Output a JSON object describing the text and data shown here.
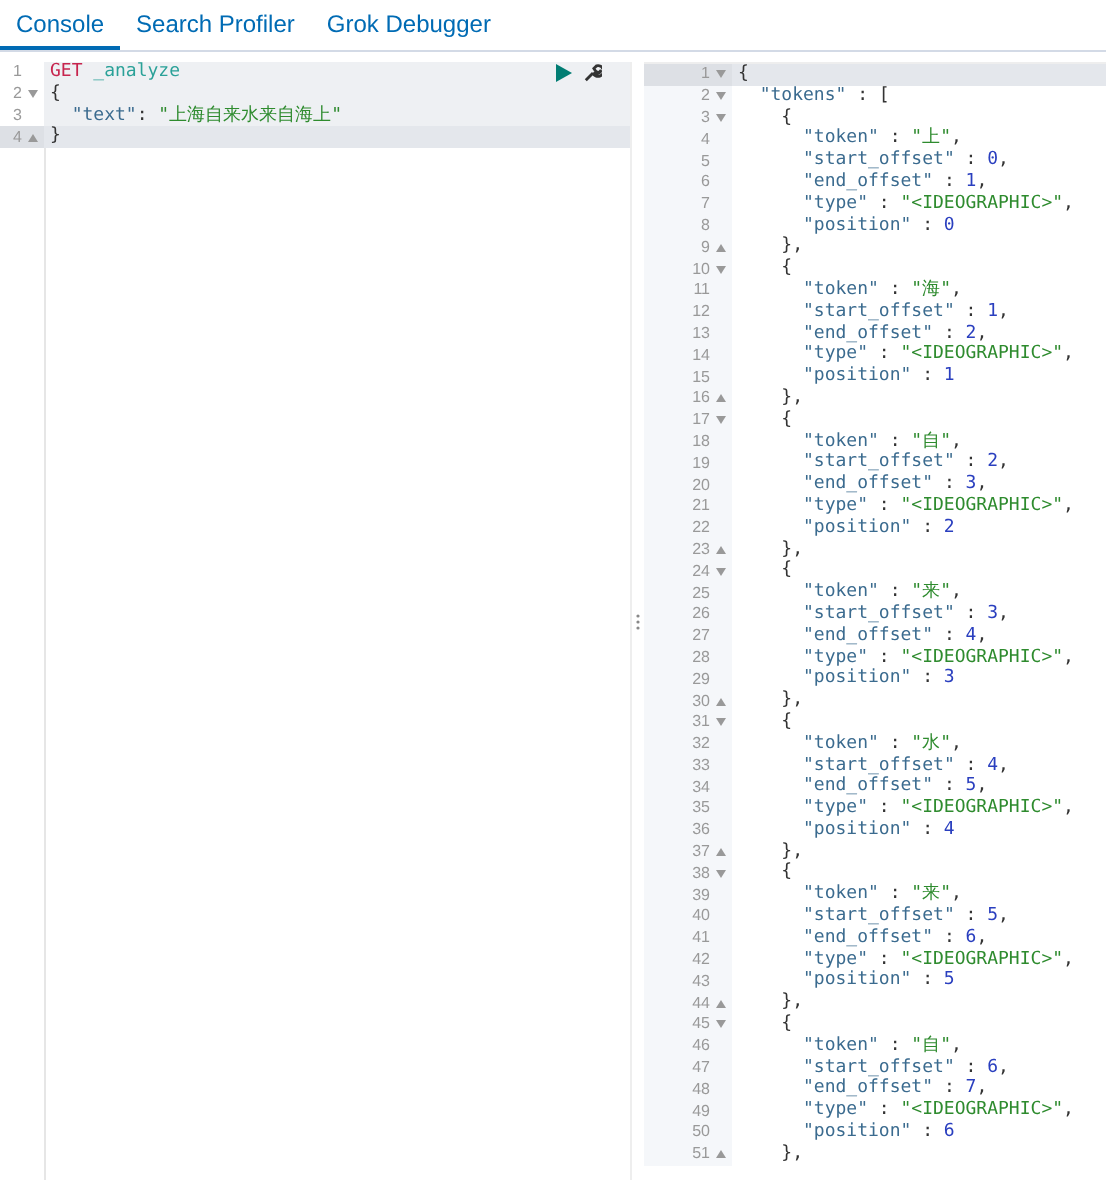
{
  "tabs": [
    {
      "label": "Console",
      "selected": true
    },
    {
      "label": "Search Profiler",
      "selected": false
    },
    {
      "label": "Grok Debugger",
      "selected": false
    }
  ],
  "request": {
    "lines": [
      {
        "n": "1",
        "active": false,
        "parts": [
          {
            "kind": "method",
            "text": "GET"
          },
          {
            "kind": "path",
            "text": "_analyze"
          }
        ]
      },
      {
        "n": "2",
        "fold_start": true,
        "active": false,
        "parts": [
          {
            "kind": "punct",
            "text": "{"
          }
        ]
      },
      {
        "n": "3",
        "active": false,
        "parts": [
          {
            "kind": "key",
            "text": "\"text\""
          },
          {
            "kind": "punct",
            "text": ":"
          },
          {
            "kind": "string",
            "text": "\"上海自来水来自海上\""
          }
        ]
      },
      {
        "n": "4",
        "fold_end": true,
        "active": true,
        "parts": [
          {
            "kind": "punct",
            "text": "}"
          }
        ]
      }
    ]
  },
  "response": {
    "lines": [
      {
        "n": "1",
        "fold_start": true,
        "active": true,
        "parts": [
          {
            "kind": "punct",
            "text": "{"
          }
        ]
      },
      {
        "n": "2",
        "fold_start": true,
        "active": false,
        "parts": [
          {
            "kind": "key",
            "text": "\"tokens\""
          },
          {
            "kind": "colon",
            "text": ":"
          },
          {
            "kind": "punct",
            "text": "["
          }
        ]
      },
      {
        "n": "3",
        "fold_start": true,
        "active": false,
        "parts": [
          {
            "kind": "punct",
            "text": "{"
          }
        ]
      },
      {
        "n": "4",
        "active": false,
        "parts": [
          {
            "kind": "key",
            "text": "\"token\""
          },
          {
            "kind": "colon",
            "text": ":"
          },
          {
            "kind": "string",
            "text": "\"上\""
          },
          {
            "kind": "punct",
            "text": ","
          }
        ]
      },
      {
        "n": "5",
        "active": false,
        "parts": [
          {
            "kind": "key",
            "text": "\"start_offset\""
          },
          {
            "kind": "colon",
            "text": ":"
          },
          {
            "kind": "number",
            "text": "0"
          },
          {
            "kind": "punct",
            "text": ","
          }
        ]
      },
      {
        "n": "6",
        "active": false,
        "parts": [
          {
            "kind": "key",
            "text": "\"end_offset\""
          },
          {
            "kind": "colon",
            "text": ":"
          },
          {
            "kind": "number",
            "text": "1"
          },
          {
            "kind": "punct",
            "text": ","
          }
        ]
      },
      {
        "n": "7",
        "active": false,
        "parts": [
          {
            "kind": "key",
            "text": "\"type\""
          },
          {
            "kind": "colon",
            "text": ":"
          },
          {
            "kind": "string",
            "text": "\"<IDEOGRAPHIC>\""
          },
          {
            "kind": "punct",
            "text": ","
          }
        ]
      },
      {
        "n": "8",
        "active": false,
        "parts": [
          {
            "kind": "key",
            "text": "\"position\""
          },
          {
            "kind": "colon",
            "text": ":"
          },
          {
            "kind": "number",
            "text": "0"
          }
        ]
      },
      {
        "n": "9",
        "fold_end": true,
        "active": false,
        "parts": [
          {
            "kind": "punct",
            "text": "},"
          }
        ]
      },
      {
        "n": "10",
        "fold_start": true,
        "active": false,
        "parts": [
          {
            "kind": "punct",
            "text": "{"
          }
        ]
      },
      {
        "n": "11",
        "active": false,
        "parts": [
          {
            "kind": "key",
            "text": "\"token\""
          },
          {
            "kind": "colon",
            "text": ":"
          },
          {
            "kind": "string",
            "text": "\"海\""
          },
          {
            "kind": "punct",
            "text": ","
          }
        ]
      },
      {
        "n": "12",
        "active": false,
        "parts": [
          {
            "kind": "key",
            "text": "\"start_offset\""
          },
          {
            "kind": "colon",
            "text": ":"
          },
          {
            "kind": "number",
            "text": "1"
          },
          {
            "kind": "punct",
            "text": ","
          }
        ]
      },
      {
        "n": "13",
        "active": false,
        "parts": [
          {
            "kind": "key",
            "text": "\"end_offset\""
          },
          {
            "kind": "colon",
            "text": ":"
          },
          {
            "kind": "number",
            "text": "2"
          },
          {
            "kind": "punct",
            "text": ","
          }
        ]
      },
      {
        "n": "14",
        "active": false,
        "parts": [
          {
            "kind": "key",
            "text": "\"type\""
          },
          {
            "kind": "colon",
            "text": ":"
          },
          {
            "kind": "string",
            "text": "\"<IDEOGRAPHIC>\""
          },
          {
            "kind": "punct",
            "text": ","
          }
        ]
      },
      {
        "n": "15",
        "active": false,
        "parts": [
          {
            "kind": "key",
            "text": "\"position\""
          },
          {
            "kind": "colon",
            "text": ":"
          },
          {
            "kind": "number",
            "text": "1"
          }
        ]
      },
      {
        "n": "16",
        "fold_end": true,
        "active": false,
        "parts": [
          {
            "kind": "punct",
            "text": "},"
          }
        ]
      },
      {
        "n": "17",
        "fold_start": true,
        "active": false,
        "parts": [
          {
            "kind": "punct",
            "text": "{"
          }
        ]
      },
      {
        "n": "18",
        "active": false,
        "parts": [
          {
            "kind": "key",
            "text": "\"token\""
          },
          {
            "kind": "colon",
            "text": ":"
          },
          {
            "kind": "string",
            "text": "\"自\""
          },
          {
            "kind": "punct",
            "text": ","
          }
        ]
      },
      {
        "n": "19",
        "active": false,
        "parts": [
          {
            "kind": "key",
            "text": "\"start_offset\""
          },
          {
            "kind": "colon",
            "text": ":"
          },
          {
            "kind": "number",
            "text": "2"
          },
          {
            "kind": "punct",
            "text": ","
          }
        ]
      },
      {
        "n": "20",
        "active": false,
        "parts": [
          {
            "kind": "key",
            "text": "\"end_offset\""
          },
          {
            "kind": "colon",
            "text": ":"
          },
          {
            "kind": "number",
            "text": "3"
          },
          {
            "kind": "punct",
            "text": ","
          }
        ]
      },
      {
        "n": "21",
        "active": false,
        "parts": [
          {
            "kind": "key",
            "text": "\"type\""
          },
          {
            "kind": "colon",
            "text": ":"
          },
          {
            "kind": "string",
            "text": "\"<IDEOGRAPHIC>\""
          },
          {
            "kind": "punct",
            "text": ","
          }
        ]
      },
      {
        "n": "22",
        "active": false,
        "parts": [
          {
            "kind": "key",
            "text": "\"position\""
          },
          {
            "kind": "colon",
            "text": ":"
          },
          {
            "kind": "number",
            "text": "2"
          }
        ]
      },
      {
        "n": "23",
        "fold_end": true,
        "active": false,
        "parts": [
          {
            "kind": "punct",
            "text": "},"
          }
        ]
      },
      {
        "n": "24",
        "fold_start": true,
        "active": false,
        "parts": [
          {
            "kind": "punct",
            "text": "{"
          }
        ]
      },
      {
        "n": "25",
        "active": false,
        "parts": [
          {
            "kind": "key",
            "text": "\"token\""
          },
          {
            "kind": "colon",
            "text": ":"
          },
          {
            "kind": "string",
            "text": "\"来\""
          },
          {
            "kind": "punct",
            "text": ","
          }
        ]
      },
      {
        "n": "26",
        "active": false,
        "parts": [
          {
            "kind": "key",
            "text": "\"start_offset\""
          },
          {
            "kind": "colon",
            "text": ":"
          },
          {
            "kind": "number",
            "text": "3"
          },
          {
            "kind": "punct",
            "text": ","
          }
        ]
      },
      {
        "n": "27",
        "active": false,
        "parts": [
          {
            "kind": "key",
            "text": "\"end_offset\""
          },
          {
            "kind": "colon",
            "text": ":"
          },
          {
            "kind": "number",
            "text": "4"
          },
          {
            "kind": "punct",
            "text": ","
          }
        ]
      },
      {
        "n": "28",
        "active": false,
        "parts": [
          {
            "kind": "key",
            "text": "\"type\""
          },
          {
            "kind": "colon",
            "text": ":"
          },
          {
            "kind": "string",
            "text": "\"<IDEOGRAPHIC>\""
          },
          {
            "kind": "punct",
            "text": ","
          }
        ]
      },
      {
        "n": "29",
        "active": false,
        "parts": [
          {
            "kind": "key",
            "text": "\"position\""
          },
          {
            "kind": "colon",
            "text": ":"
          },
          {
            "kind": "number",
            "text": "3"
          }
        ]
      },
      {
        "n": "30",
        "fold_end": true,
        "active": false,
        "parts": [
          {
            "kind": "punct",
            "text": "},"
          }
        ]
      },
      {
        "n": "31",
        "fold_start": true,
        "active": false,
        "parts": [
          {
            "kind": "punct",
            "text": "{"
          }
        ]
      },
      {
        "n": "32",
        "active": false,
        "parts": [
          {
            "kind": "key",
            "text": "\"token\""
          },
          {
            "kind": "colon",
            "text": ":"
          },
          {
            "kind": "string",
            "text": "\"水\""
          },
          {
            "kind": "punct",
            "text": ","
          }
        ]
      },
      {
        "n": "33",
        "active": false,
        "parts": [
          {
            "kind": "key",
            "text": "\"start_offset\""
          },
          {
            "kind": "colon",
            "text": ":"
          },
          {
            "kind": "number",
            "text": "4"
          },
          {
            "kind": "punct",
            "text": ","
          }
        ]
      },
      {
        "n": "34",
        "active": false,
        "parts": [
          {
            "kind": "key",
            "text": "\"end_offset\""
          },
          {
            "kind": "colon",
            "text": ":"
          },
          {
            "kind": "number",
            "text": "5"
          },
          {
            "kind": "punct",
            "text": ","
          }
        ]
      },
      {
        "n": "35",
        "active": false,
        "parts": [
          {
            "kind": "key",
            "text": "\"type\""
          },
          {
            "kind": "colon",
            "text": ":"
          },
          {
            "kind": "string",
            "text": "\"<IDEOGRAPHIC>\""
          },
          {
            "kind": "punct",
            "text": ","
          }
        ]
      },
      {
        "n": "36",
        "active": false,
        "parts": [
          {
            "kind": "key",
            "text": "\"position\""
          },
          {
            "kind": "colon",
            "text": ":"
          },
          {
            "kind": "number",
            "text": "4"
          }
        ]
      },
      {
        "n": "37",
        "fold_end": true,
        "active": false,
        "parts": [
          {
            "kind": "punct",
            "text": "},"
          }
        ]
      },
      {
        "n": "38",
        "fold_start": true,
        "active": false,
        "parts": [
          {
            "kind": "punct",
            "text": "{"
          }
        ]
      },
      {
        "n": "39",
        "active": false,
        "parts": [
          {
            "kind": "key",
            "text": "\"token\""
          },
          {
            "kind": "colon",
            "text": ":"
          },
          {
            "kind": "string",
            "text": "\"来\""
          },
          {
            "kind": "punct",
            "text": ","
          }
        ]
      },
      {
        "n": "40",
        "active": false,
        "parts": [
          {
            "kind": "key",
            "text": "\"start_offset\""
          },
          {
            "kind": "colon",
            "text": ":"
          },
          {
            "kind": "number",
            "text": "5"
          },
          {
            "kind": "punct",
            "text": ","
          }
        ]
      },
      {
        "n": "41",
        "active": false,
        "parts": [
          {
            "kind": "key",
            "text": "\"end_offset\""
          },
          {
            "kind": "colon",
            "text": ":"
          },
          {
            "kind": "number",
            "text": "6"
          },
          {
            "kind": "punct",
            "text": ","
          }
        ]
      },
      {
        "n": "42",
        "active": false,
        "parts": [
          {
            "kind": "key",
            "text": "\"type\""
          },
          {
            "kind": "colon",
            "text": ":"
          },
          {
            "kind": "string",
            "text": "\"<IDEOGRAPHIC>\""
          },
          {
            "kind": "punct",
            "text": ","
          }
        ]
      },
      {
        "n": "43",
        "active": false,
        "parts": [
          {
            "kind": "key",
            "text": "\"position\""
          },
          {
            "kind": "colon",
            "text": ":"
          },
          {
            "kind": "number",
            "text": "5"
          }
        ]
      },
      {
        "n": "44",
        "fold_end": true,
        "active": false,
        "parts": [
          {
            "kind": "punct",
            "text": "},"
          }
        ]
      },
      {
        "n": "45",
        "fold_start": true,
        "active": false,
        "parts": [
          {
            "kind": "punct",
            "text": "{"
          }
        ]
      },
      {
        "n": "46",
        "active": false,
        "parts": [
          {
            "kind": "key",
            "text": "\"token\""
          },
          {
            "kind": "colon",
            "text": ":"
          },
          {
            "kind": "string",
            "text": "\"自\""
          },
          {
            "kind": "punct",
            "text": ","
          }
        ]
      },
      {
        "n": "47",
        "active": false,
        "parts": [
          {
            "kind": "key",
            "text": "\"start_offset\""
          },
          {
            "kind": "colon",
            "text": ":"
          },
          {
            "kind": "number",
            "text": "6"
          },
          {
            "kind": "punct",
            "text": ","
          }
        ]
      },
      {
        "n": "48",
        "active": false,
        "parts": [
          {
            "kind": "key",
            "text": "\"end_offset\""
          },
          {
            "kind": "colon",
            "text": ":"
          },
          {
            "kind": "number",
            "text": "7"
          },
          {
            "kind": "punct",
            "text": ","
          }
        ]
      },
      {
        "n": "49",
        "active": false,
        "parts": [
          {
            "kind": "key",
            "text": "\"type\""
          },
          {
            "kind": "colon",
            "text": ":"
          },
          {
            "kind": "string",
            "text": "\"<IDEOGRAPHIC>\""
          },
          {
            "kind": "punct",
            "text": ","
          }
        ]
      },
      {
        "n": "50",
        "active": false,
        "parts": [
          {
            "kind": "key",
            "text": "\"position\""
          },
          {
            "kind": "colon",
            "text": ":"
          },
          {
            "kind": "number",
            "text": "6"
          }
        ]
      },
      {
        "n": "51",
        "fold_end": true,
        "active": false,
        "parts": [
          {
            "kind": "punct",
            "text": "},"
          }
        ]
      }
    ]
  }
}
